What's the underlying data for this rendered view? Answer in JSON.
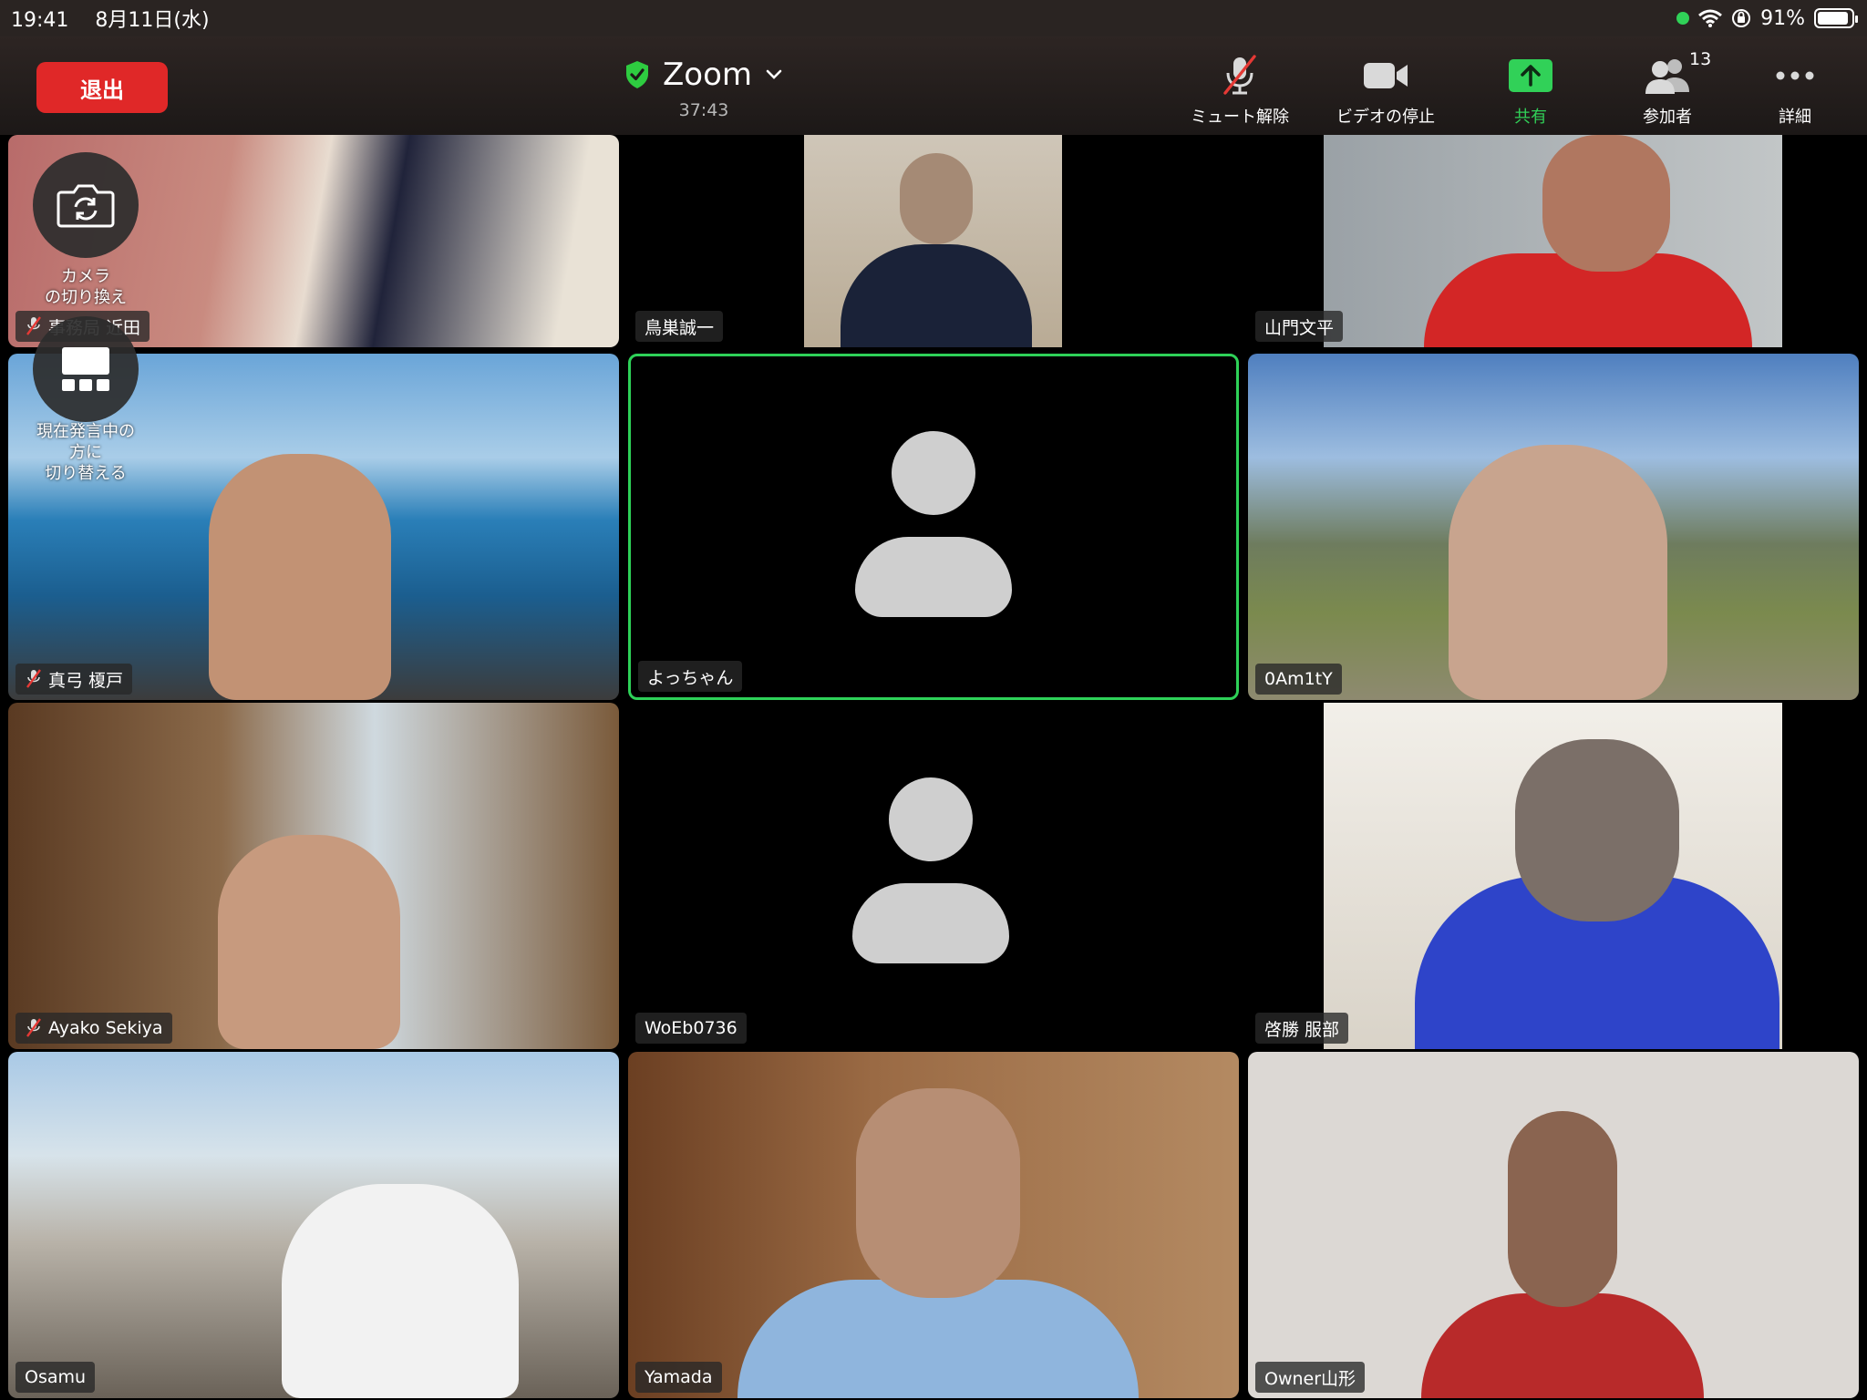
{
  "status": {
    "time": "19:41",
    "date": "8月11日(水)",
    "battery": "91%",
    "battery_level": 0.91,
    "icons": [
      "wifi-icon",
      "orientation-lock-icon",
      "battery-icon"
    ]
  },
  "toolbar": {
    "leave_label": "退出",
    "meeting_title": "Zoom",
    "meeting_timer": "37:43",
    "unmute_label": "ミュート解除",
    "stop_video_label": "ビデオの停止",
    "share_label": "共有",
    "participants_label": "参加者",
    "participants_count": "13",
    "more_label": "詳細"
  },
  "floating": {
    "switch_camera_label": "カメラ\nの切り換え",
    "switch_view_label": "現在発言中の\n方に\n切り替える"
  },
  "participants": [
    {
      "name": "事務局 近田",
      "muted": true,
      "video": true
    },
    {
      "name": "鳥巣誠一",
      "muted": false,
      "video": true
    },
    {
      "name": "山門文平",
      "muted": false,
      "video": true
    },
    {
      "name": "真弓 榎戸",
      "muted": true,
      "video": true
    },
    {
      "name": "よっちゃん",
      "muted": false,
      "video": false,
      "active_speaker": true
    },
    {
      "name": "0Am1tY",
      "muted": false,
      "video": true
    },
    {
      "name": "Ayako Sekiya",
      "muted": true,
      "video": true
    },
    {
      "name": "WoEb0736",
      "muted": false,
      "video": false
    },
    {
      "name": "啓勝 服部",
      "muted": false,
      "video": true
    },
    {
      "name": "Osamu",
      "muted": false,
      "video": true
    },
    {
      "name": "Yamada",
      "muted": false,
      "video": true
    },
    {
      "name": "Owner山形",
      "muted": false,
      "video": true
    }
  ],
  "colors": {
    "leave": "#e02828",
    "active_border": "#2ed158",
    "share": "#31d158",
    "mute_slash": "#e53935"
  }
}
